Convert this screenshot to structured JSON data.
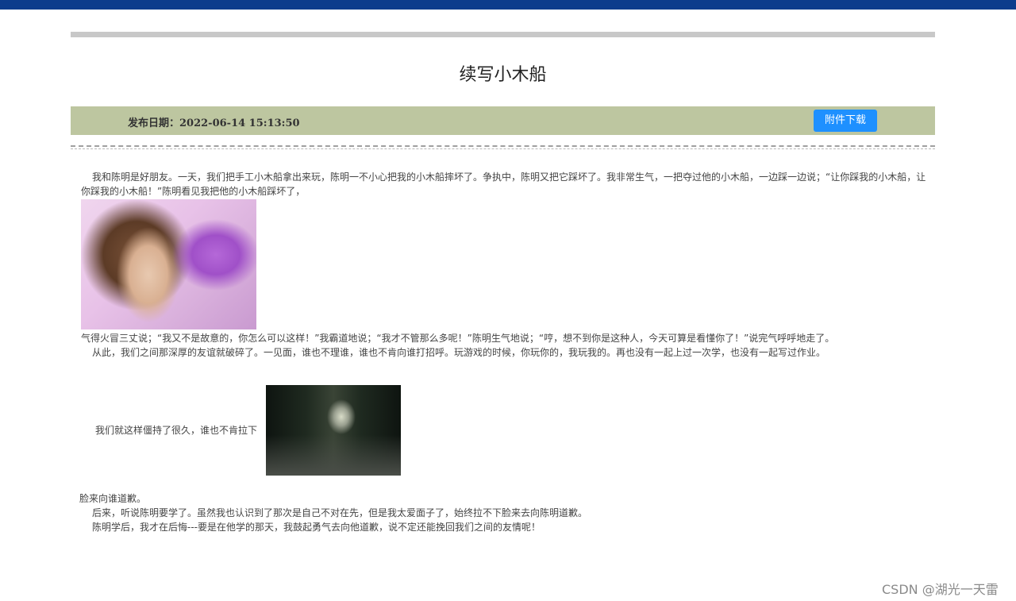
{
  "article": {
    "title": "续写小木船",
    "publish_date": "发布日期：2022-06-14 15:13:50",
    "download_label": "附件下载",
    "paragraphs": {
      "p1": "我和陈明是好朋友。一天，我们把手工小木船拿出来玩，陈明一不小心把我的小木船摔坏了。争执中，陈明又把它踩坏了。我非常生气，一把夺过他的小木船，一边踩一边说；“让你踩我的小木船，让你踩我的小木船！”陈明看见我把他的小木船踩坏了，",
      "p2": "气得火冒三丈说；“我又不是故意的，你怎么可以这样！”我霸道地说；“我才不管那么多呢！”陈明生气地说；“哼，想不到你是这种人，今天可算是看懂你了！”说完气呼呼地走了。",
      "p3": "从此，我们之间那深厚的友谊就破碎了。一见面，谁也不理谁，谁也不肯向谁打招呼。玩游戏的时候，你玩你的，我玩我的。再也没有一起上过一次学，也没有一起写过作业。",
      "p4a": "我们就这样僵持了很久，谁也不肯拉下",
      "p4b": "脸来向谁道歉。",
      "p5": "后来，听说陈明要学了。虽然我也认识到了那次是自己不对在先，但是我太爱面子了，始终拉不下脸来去向陈明道歉。",
      "p6": "陈明学后，我才在后悔---要是在他学的那天，我鼓起勇气去向他道歉，说不定还能挽回我们之间的友情呢！"
    }
  },
  "watermark": "CSDN @湖光一天雷",
  "colors": {
    "top_bar": "#0c3c8c",
    "meta_bar": "#bdc6a0",
    "button": "#1e90ff"
  }
}
